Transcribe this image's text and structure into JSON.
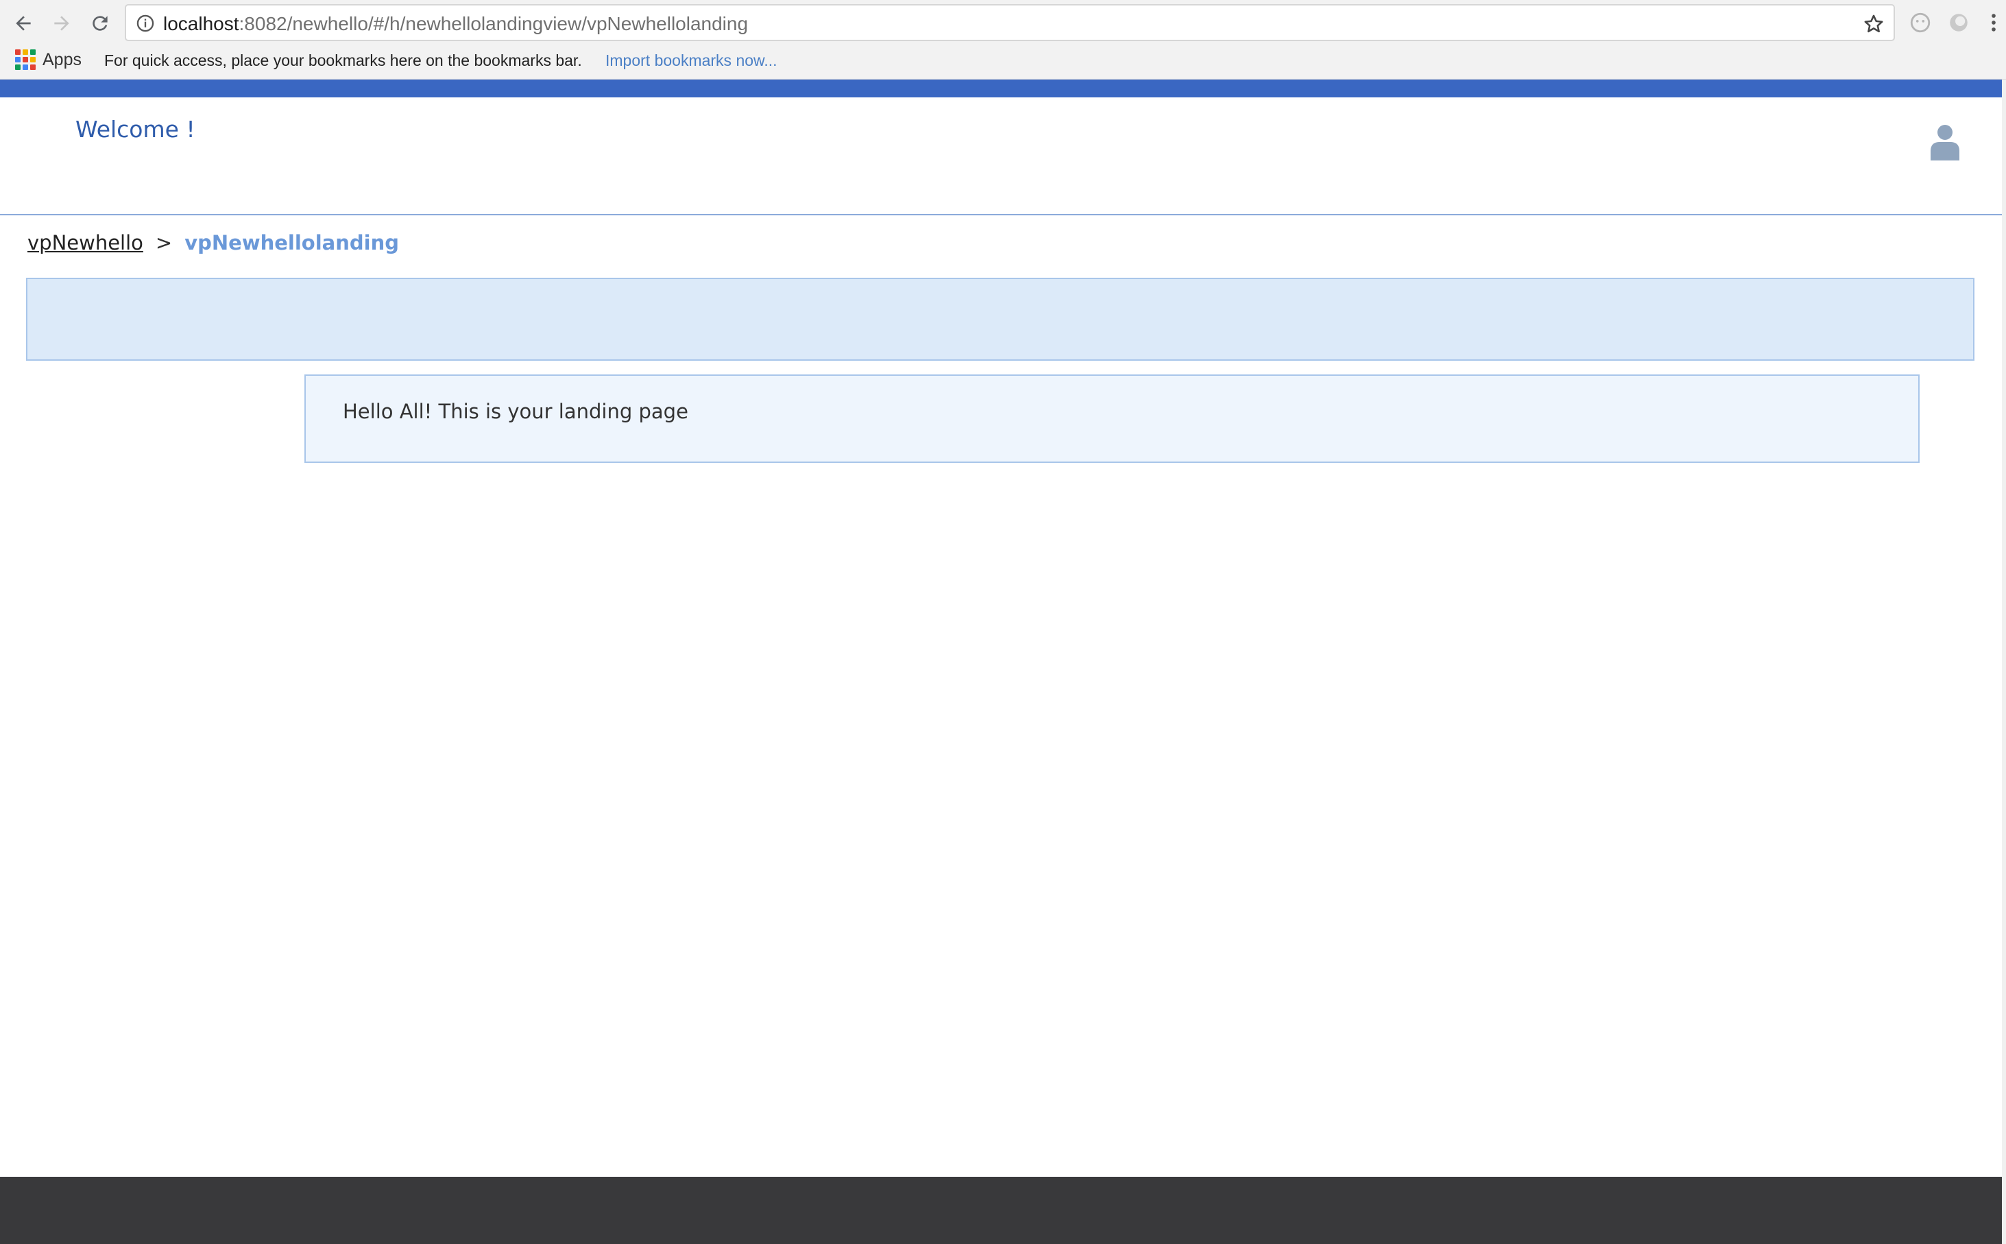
{
  "browser": {
    "url_host": "localhost",
    "url_rest": ":8082/newhello/#/h/newhellolandingview/vpNewhellolanding",
    "bookmarks_bar": {
      "apps_label": "Apps",
      "hint": "For quick access, place your bookmarks here on the bookmarks bar.",
      "import_link": "Import bookmarks now..."
    }
  },
  "header": {
    "welcome": "Welcome !",
    "accent_color": "#3a67c2"
  },
  "breadcrumb": {
    "parent": "vpNewhello",
    "separator": ">",
    "current": "vpNewhellolanding"
  },
  "main": {
    "message": "Hello All! This is your landing page"
  },
  "icons": {
    "back": "back-arrow-icon",
    "forward": "forward-arrow-icon",
    "reload": "reload-icon",
    "info": "info-icon",
    "star": "star-icon",
    "apps": "apps-grid-icon",
    "user": "user-icon"
  }
}
